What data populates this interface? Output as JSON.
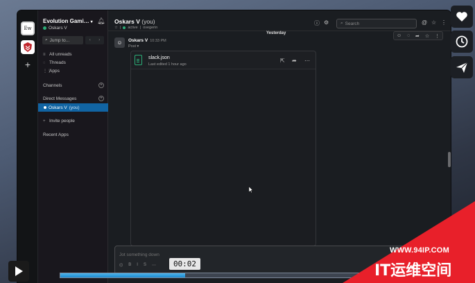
{
  "workspace": {
    "name": "Evolution Gami…",
    "user": "Oskars V",
    "tile_label": "Ew"
  },
  "sidebar": {
    "jump_label": "Jump to...",
    "items": [
      {
        "label": "All unreads",
        "icon": "unreads-icon"
      },
      {
        "label": "Threads",
        "icon": "threads-icon"
      },
      {
        "label": "Apps",
        "icon": "apps-icon"
      }
    ],
    "channels_label": "Channels",
    "dm_label": "Direct Messages",
    "dm_active": {
      "name": "Oskars V",
      "suffix": "(you)"
    },
    "invite_label": "Invite people",
    "recent_apps_label": "Recent Apps"
  },
  "channel": {
    "title": "Oskars V",
    "title_suffix": "(you)",
    "status": "active",
    "meta_extra": "ovegerin",
    "search_placeholder": "Search"
  },
  "messages": {
    "day_divider": "Yesterday",
    "author": "Oskars V",
    "time": "10:33 PM",
    "sub": "Post ▾"
  },
  "file": {
    "name": "slack.json",
    "edited": "Last edited 1 hour ago"
  },
  "composer": {
    "placeholder": "Jot something down"
  },
  "player": {
    "time": "00:02",
    "progress": 0.34
  },
  "watermark": {
    "url": "WWW.94IP.COM",
    "brand": "IT运维空间"
  },
  "colors": {
    "accent": "#1164a3",
    "online": "#2bac76",
    "progress": "#1c8bd0",
    "watermark": "#e8202a"
  }
}
